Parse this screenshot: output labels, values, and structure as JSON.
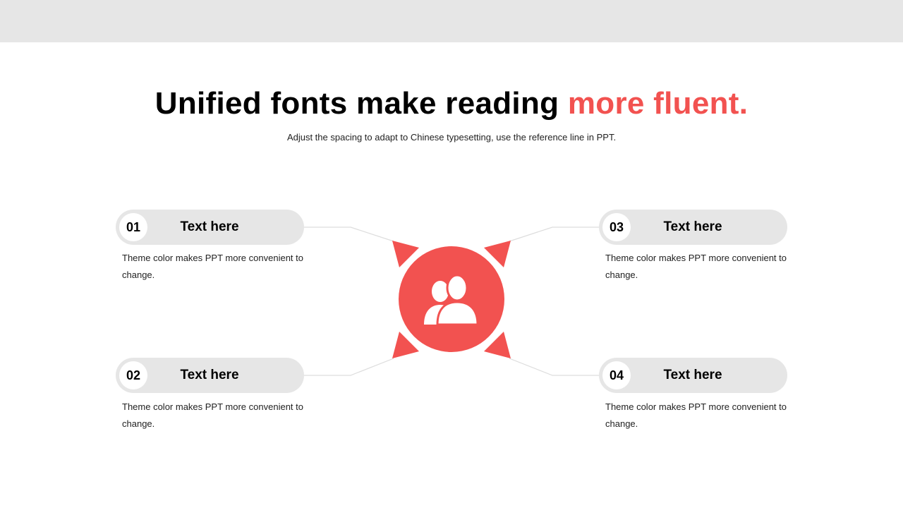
{
  "header": {
    "title_main": "Unified fonts make reading ",
    "title_accent": "more fluent.",
    "subtitle": "Adjust the spacing to adapt to Chinese typesetting, use the reference line in PPT."
  },
  "colors": {
    "accent": "#f25250",
    "pill": "#e6e6e6",
    "band": "#e6e6e6",
    "connector": "#dddddd"
  },
  "hub": {
    "icon": "users-icon"
  },
  "items": [
    {
      "number": "01",
      "title": "Text here",
      "text": "Theme color makes PPT more convenient to change."
    },
    {
      "number": "02",
      "title": "Text here",
      "text": "Theme color makes PPT more convenient to change."
    },
    {
      "number": "03",
      "title": "Text here",
      "text": "Theme color makes PPT more convenient to change."
    },
    {
      "number": "04",
      "title": "Text here",
      "text": "Theme color makes PPT more convenient to change."
    }
  ]
}
